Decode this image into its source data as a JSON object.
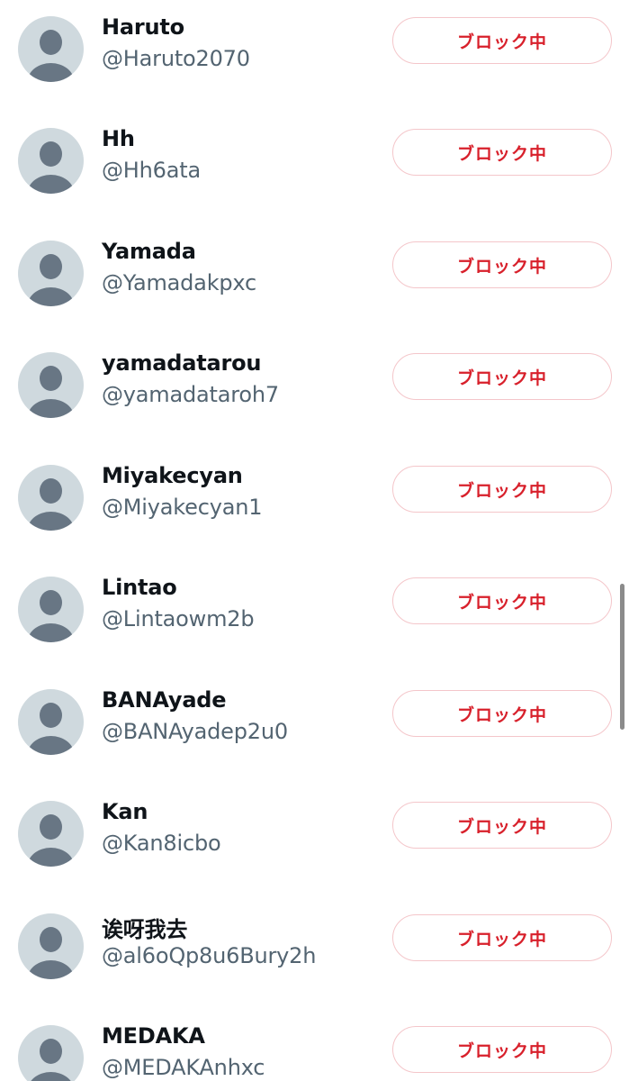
{
  "blocked_users": [
    {
      "name": "Haruto",
      "handle": "@Haruto2070",
      "button_label": "ブロック中"
    },
    {
      "name": "Hh",
      "handle": "@Hh6ata",
      "button_label": "ブロック中"
    },
    {
      "name": "Yamada",
      "handle": "@Yamadakpxc",
      "button_label": "ブロック中"
    },
    {
      "name": "yamadatarou",
      "handle": "@yamadataroh7",
      "button_label": "ブロック中"
    },
    {
      "name": "Miyakecyan",
      "handle": "@Miyakecyan1",
      "button_label": "ブロック中"
    },
    {
      "name": "Lintao",
      "handle": "@Lintaowm2b",
      "button_label": "ブロック中"
    },
    {
      "name": "BANAyade",
      "handle": "@BANAyadep2u0",
      "button_label": "ブロック中"
    },
    {
      "name": "Kan",
      "handle": "@Kan8icbo",
      "button_label": "ブロック中"
    },
    {
      "name": "诶呀我去",
      "handle": "@al6oQp8u6Bury2h",
      "button_label": "ブロック中"
    },
    {
      "name": "MEDAKA",
      "handle": "@MEDAKAnhxc",
      "button_label": "ブロック中"
    }
  ],
  "colors": {
    "button_text": "#d8202b",
    "button_border": "#f4c6ca",
    "avatar_bg": "#cfd9de",
    "avatar_figure": "#687684",
    "name_text": "#0f1419",
    "handle_text": "#536471"
  },
  "icons": {
    "avatar": "default-profile-silhouette-icon"
  }
}
